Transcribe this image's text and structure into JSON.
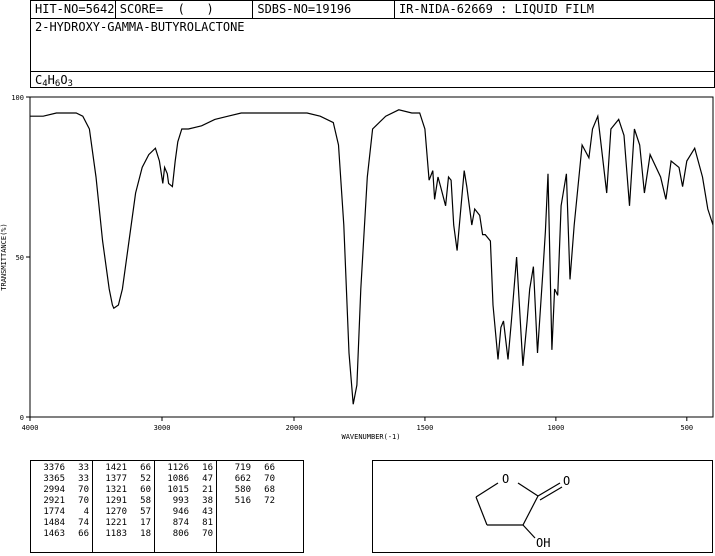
{
  "header": {
    "hit_no": "HIT-NO=5642",
    "score": "SCORE=  (   )",
    "sdbs_no": "SDBS-NO=19196",
    "ir_info": "IR-NIDA-62669 : LIQUID FILM",
    "compound_name": "2-HYDROXY-GAMMA-BUTYROLACTONE",
    "formula_parts": [
      "C",
      "4",
      "H",
      "6",
      "O",
      "3"
    ]
  },
  "chart_data": {
    "type": "line",
    "xlabel": "WAVENUMBER(-1)",
    "ylabel": "TRANSMITTANCE(%)",
    "xlim": [
      4000,
      400
    ],
    "ylim": [
      0,
      100
    ],
    "x_ticks": [
      4000,
      3000,
      2000,
      1500,
      1000,
      500
    ],
    "y_ticks": [
      0,
      50,
      100
    ],
    "x": [
      4000,
      3900,
      3800,
      3700,
      3650,
      3600,
      3550,
      3500,
      3450,
      3400,
      3376,
      3365,
      3330,
      3300,
      3250,
      3200,
      3150,
      3100,
      3050,
      3020,
      2994,
      2980,
      2960,
      2950,
      2921,
      2900,
      2880,
      2850,
      2800,
      2700,
      2600,
      2500,
      2400,
      2300,
      2200,
      2100,
      2000,
      1950,
      1900,
      1850,
      1830,
      1810,
      1790,
      1774,
      1760,
      1745,
      1720,
      1700,
      1650,
      1600,
      1550,
      1520,
      1500,
      1484,
      1470,
      1463,
      1450,
      1440,
      1421,
      1410,
      1400,
      1390,
      1377,
      1350,
      1340,
      1321,
      1310,
      1291,
      1280,
      1270,
      1250,
      1240,
      1221,
      1210,
      1200,
      1183,
      1170,
      1150,
      1126,
      1110,
      1100,
      1086,
      1070,
      1050,
      1040,
      1030,
      1015,
      1005,
      993,
      980,
      960,
      946,
      930,
      900,
      874,
      860,
      840,
      806,
      790,
      760,
      740,
      719,
      700,
      680,
      662,
      640,
      600,
      580,
      560,
      530,
      516,
      500,
      470,
      440,
      420,
      400
    ],
    "y": [
      94,
      94,
      95,
      95,
      95,
      94,
      90,
      75,
      55,
      40,
      35,
      34,
      35,
      40,
      55,
      70,
      78,
      82,
      84,
      80,
      73,
      78,
      76,
      73,
      72,
      80,
      86,
      90,
      90,
      91,
      93,
      94,
      95,
      95,
      95,
      95,
      95,
      95,
      94,
      92,
      85,
      60,
      20,
      4,
      10,
      40,
      75,
      90,
      94,
      96,
      95,
      95,
      90,
      74,
      77,
      68,
      75,
      72,
      66,
      75,
      74,
      60,
      52,
      77,
      72,
      60,
      65,
      63,
      57,
      57,
      55,
      35,
      18,
      28,
      30,
      18,
      30,
      50,
      16,
      30,
      40,
      47,
      20,
      45,
      58,
      76,
      21,
      40,
      38,
      66,
      76,
      43,
      60,
      85,
      81,
      90,
      94,
      70,
      90,
      93,
      88,
      66,
      90,
      85,
      70,
      82,
      75,
      68,
      80,
      78,
      72,
      80,
      84,
      75,
      65,
      60
    ],
    "peaks": [
      {
        "wn": 3376,
        "tr": 33
      },
      {
        "wn": 3365,
        "tr": 33
      },
      {
        "wn": 2994,
        "tr": 70
      },
      {
        "wn": 2921,
        "tr": 70
      },
      {
        "wn": 1774,
        "tr": 4
      },
      {
        "wn": 1484,
        "tr": 74
      },
      {
        "wn": 1463,
        "tr": 66
      },
      {
        "wn": 1421,
        "tr": 66
      },
      {
        "wn": 1377,
        "tr": 52
      },
      {
        "wn": 1321,
        "tr": 60
      },
      {
        "wn": 1291,
        "tr": 58
      },
      {
        "wn": 1270,
        "tr": 57
      },
      {
        "wn": 1221,
        "tr": 17
      },
      {
        "wn": 1183,
        "tr": 18
      },
      {
        "wn": 1126,
        "tr": 16
      },
      {
        "wn": 1086,
        "tr": 47
      },
      {
        "wn": 1015,
        "tr": 21
      },
      {
        "wn": 993,
        "tr": 38
      },
      {
        "wn": 946,
        "tr": 43
      },
      {
        "wn": 874,
        "tr": 81
      },
      {
        "wn": 806,
        "tr": 70
      },
      {
        "wn": 719,
        "tr": 66
      },
      {
        "wn": 662,
        "tr": 70
      },
      {
        "wn": 580,
        "tr": 68
      },
      {
        "wn": 516,
        "tr": 72
      }
    ],
    "grid": false,
    "line_color": "#000000"
  },
  "structure": {
    "atom_O_ring": "O",
    "atom_O_carbonyl": "O",
    "atom_OH": "OH"
  }
}
